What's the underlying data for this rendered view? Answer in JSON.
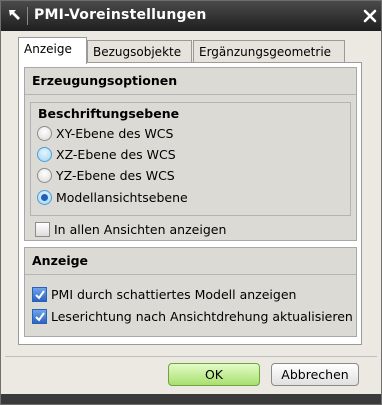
{
  "window": {
    "title": "PMI-Voreinstellungen",
    "close_icon": "close-icon",
    "title_icon": "resize-arrow-icon"
  },
  "tabs": [
    {
      "label": "Anzeige",
      "active": true
    },
    {
      "label": "Bezugsobjekte",
      "active": false
    },
    {
      "label": "Ergänzungsgeometrie",
      "active": false
    }
  ],
  "erzeugung": {
    "title": "Erzeugungsoptionen",
    "beschriftung": {
      "title": "Beschriftungsebene",
      "options": [
        {
          "label": "XY-Ebene des WCS",
          "selected": false
        },
        {
          "label": "XZ-Ebene des WCS",
          "selected": false,
          "hovered": true
        },
        {
          "label": "YZ-Ebene des WCS",
          "selected": false
        },
        {
          "label": "Modellansichtsebene",
          "selected": true
        }
      ]
    },
    "all_views": {
      "label": "In allen Ansichten anzeigen",
      "checked": false
    }
  },
  "anzeige": {
    "title": "Anzeige",
    "options": [
      {
        "label": "PMI durch schattiertes Modell anzeigen",
        "checked": true
      },
      {
        "label": "Leserichtung nach Ansichtdrehung aktualisieren",
        "checked": true
      }
    ]
  },
  "buttons": {
    "ok": "OK",
    "cancel": "Abbrechen"
  },
  "colors": {
    "titlebar": "#2b2b2b",
    "ok_button": "#a8e06e",
    "check_blue": "#2b63c4"
  }
}
